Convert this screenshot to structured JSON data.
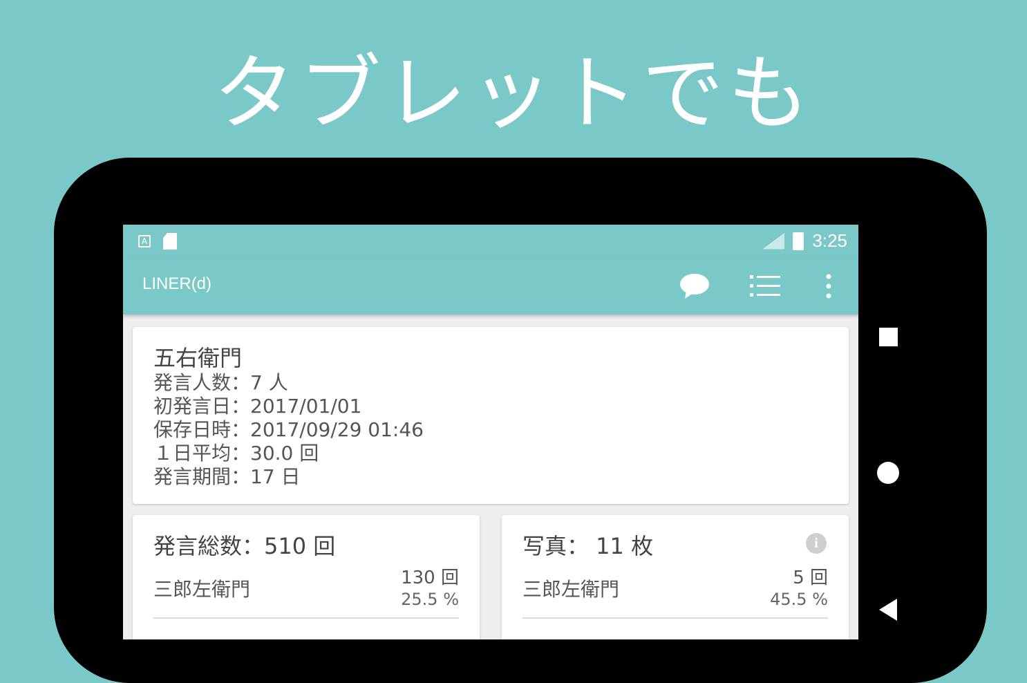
{
  "headline": "タブレットでも",
  "statusbar": {
    "time": "3:25",
    "icons": [
      "a-notification-icon",
      "sd-card-icon",
      "lte-signal-icon",
      "battery-icon"
    ]
  },
  "appbar": {
    "title": "LINER(d)",
    "icons": [
      "chat-bubble-icon",
      "list-icon",
      "more-vert-icon"
    ]
  },
  "summary": {
    "group_name": "五右衛門",
    "lines": [
      "発言人数：7 人",
      "初発言日：2017/01/01",
      "保存日時：2017/09/29 01:46",
      "１日平均：30.0 回",
      "発言期間：17 日"
    ]
  },
  "messages_card": {
    "title": "発言総数：510 回",
    "top_name": "三郎左衛門",
    "top_count": "130 回",
    "top_pct": "25.5 %"
  },
  "photos_card": {
    "title": "写真： 11 枚",
    "top_name": "三郎左衛門",
    "top_count": "5 回",
    "top_pct": "45.5 %",
    "info_glyph": "i"
  },
  "colors": {
    "accent": "#7bc8c8",
    "frame": "#000000",
    "card": "#ffffff"
  }
}
